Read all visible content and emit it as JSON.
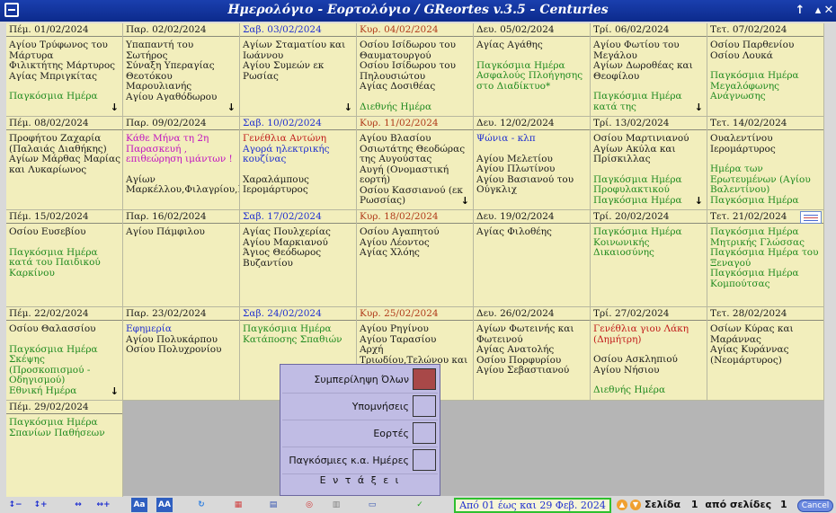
{
  "window": {
    "title": "Ημερολόγιο - Εορτολόγιο / GReortes v.3.5 - Centuries"
  },
  "colors": {
    "titlebar": "#0c2a8c",
    "cell_bg": "#f2eebc",
    "saturday": "#1f2fd0",
    "sunday": "#b03a1a",
    "world_day": "#1f8a1f",
    "popup_bg": "#c0bce4"
  },
  "weeks": [
    [
      {
        "header": "Πέμ. 01/02/2024",
        "hdr_color": "black",
        "lines": [
          {
            "t": "Αγίου Τρύφωνος του Μάρτυρα",
            "c": "black"
          },
          {
            "t": "Φιλικτήτης Μάρτυρος",
            "c": "black"
          },
          {
            "t": "Αγίας Μπριγκίτας",
            "c": "black"
          },
          {
            "gap": true
          },
          {
            "t": "Παγκόσμια Ημέρα",
            "c": "green"
          }
        ],
        "arrow": true
      },
      {
        "header": "Παρ. 02/02/2024",
        "hdr_color": "black",
        "lines": [
          {
            "t": "Υπαπαντή του Σωτήρος",
            "c": "black"
          },
          {
            "t": "Σύναξη Υπεραγίας Θεοτόκου Μαρουλιανής",
            "c": "black"
          },
          {
            "t": "Αγίου Αγαθόδωρου",
            "c": "black"
          }
        ],
        "arrow": true
      },
      {
        "header": "Σαβ. 03/02/2024",
        "hdr_color": "blue",
        "lines": [
          {
            "t": "Αγίων Σταματίου και Ιωάννου",
            "c": "black"
          },
          {
            "t": "Αγίου Συμεών εκ Ρωσίας",
            "c": "black"
          }
        ],
        "arrow": true
      },
      {
        "header": "Κυρ. 04/02/2024",
        "hdr_color": "red",
        "lines": [
          {
            "t": "Οσίου Ισίδωρου του Θαυματουργού",
            "c": "black"
          },
          {
            "t": "Οσίου Ισίδωρου του Πηλουσιώτου",
            "c": "black"
          },
          {
            "t": "Αγίας Δοσιθέας",
            "c": "black"
          },
          {
            "gap": true
          },
          {
            "t": "Διεθνής Ημέρα",
            "c": "green"
          }
        ],
        "arrow": false
      },
      {
        "header": "Δευ. 05/02/2024",
        "hdr_color": "black",
        "lines": [
          {
            "t": "Αγίας Αγάθης",
            "c": "black"
          },
          {
            "gap": true
          },
          {
            "t": "Παγκόσμια Ημέρα Ασφαλούς Πλοήγησης στο Διαδίκτυο*",
            "c": "green"
          }
        ],
        "arrow": false
      },
      {
        "header": "Τρί. 06/02/2024",
        "hdr_color": "black",
        "lines": [
          {
            "t": "Αγίου Φωτίου του Μεγάλου",
            "c": "black"
          },
          {
            "t": "Αγίων Δωροθέας και Θεοφίλου",
            "c": "black"
          },
          {
            "gap": true
          },
          {
            "t": "Παγκόσμια Ημέρα κατά της",
            "c": "green"
          }
        ],
        "arrow": true
      },
      {
        "header": "Τετ. 07/02/2024",
        "hdr_color": "black",
        "lines": [
          {
            "t": "Οσίου Παρθενίου",
            "c": "black"
          },
          {
            "t": "Οσίου Λουκά",
            "c": "black"
          },
          {
            "gap": true
          },
          {
            "t": "Παγκόσμια Ημέρα Μεγαλόφωνης Ανάγνωσης",
            "c": "green"
          }
        ],
        "arrow": false
      }
    ],
    [
      {
        "header": "Πέμ. 08/02/2024",
        "hdr_color": "black",
        "lines": [
          {
            "t": "Προφήτου Ζαχαρία (Παλαιάς Διαθήκης)",
            "c": "black"
          },
          {
            "t": "Αγίων Μάρθας Μαρίας και Λυκαρίωνος",
            "c": "black"
          }
        ],
        "arrow": false
      },
      {
        "header": "Παρ. 09/02/2024",
        "hdr_color": "black",
        "lines": [
          {
            "t": "Κάθε Μήνα τη 2η Παρασκευή , επιθεώρηση ιμάντων !",
            "c": "magenta"
          },
          {
            "gap": true
          },
          {
            "t": "Αγίων Μαρκέλλου,Φιλαγρίου,Παγκρατίου",
            "c": "black"
          }
        ],
        "arrow": false
      },
      {
        "header": "Σαβ. 10/02/2024",
        "hdr_color": "blue",
        "lines": [
          {
            "t": "Γενέθλια Αντώνη",
            "c": "crimson"
          },
          {
            "t": "Αγορά ηλεκτρικής κουζίνας",
            "c": "blue"
          },
          {
            "gap": true
          },
          {
            "t": "Χαραλάμπους Ιερομάρτυρος",
            "c": "black"
          }
        ],
        "arrow": false
      },
      {
        "header": "Κυρ. 11/02/2024",
        "hdr_color": "red",
        "lines": [
          {
            "t": "Αγίου Βλασίου",
            "c": "black"
          },
          {
            "t": "Οσιωτάτης Θεοδώρας της Αυγούστας",
            "c": "black"
          },
          {
            "t": "Αυγή (Ονομαστική εορτή)",
            "c": "black"
          },
          {
            "t": "Οσίου Κασσιανού (εκ Ρωσσίας)",
            "c": "black"
          }
        ],
        "arrow": true
      },
      {
        "header": "Δευ. 12/02/2024",
        "hdr_color": "black",
        "lines": [
          {
            "t": "Ψώνια - κλπ",
            "c": "blue"
          },
          {
            "gap": true
          },
          {
            "t": "Αγίου Μελετίου",
            "c": "black"
          },
          {
            "t": "Αγίου Πλωτίνου",
            "c": "black"
          },
          {
            "t": "Αγίου Βασιανού του Ούγκλιχ",
            "c": "black"
          }
        ],
        "arrow": false
      },
      {
        "header": "Τρί. 13/02/2024",
        "hdr_color": "black",
        "lines": [
          {
            "t": "Οσίου Μαρτινιανού",
            "c": "black"
          },
          {
            "t": "Αγίων Ακύλα και Πρίσκιλλας",
            "c": "black"
          },
          {
            "gap": true
          },
          {
            "t": "Παγκόσμια Ημέρα Προφυλακτικού",
            "c": "green"
          },
          {
            "t": "Παγκόσμια Ημέρα",
            "c": "green"
          }
        ],
        "arrow": true
      },
      {
        "header": "Τετ. 14/02/2024",
        "hdr_color": "black",
        "lines": [
          {
            "t": "Ουαλεντίνου Ιερομάρτυρος",
            "c": "black"
          },
          {
            "gap": true
          },
          {
            "t": "Ημέρα των Ερωτευμένων (Αγίου Βαλεντίνου)",
            "c": "green"
          },
          {
            "t": "Παγκόσμια Ημέρα",
            "c": "green"
          }
        ],
        "arrow": false
      }
    ],
    [
      {
        "header": "Πέμ. 15/02/2024",
        "hdr_color": "black",
        "lines": [
          {
            "t": "Οσίου Ευσεβίου",
            "c": "black"
          },
          {
            "gap": true
          },
          {
            "t": "Παγκόσμια Ημέρα κατά του Παιδικού Καρκίνου",
            "c": "green"
          }
        ],
        "arrow": false
      },
      {
        "header": "Παρ. 16/02/2024",
        "hdr_color": "black",
        "lines": [
          {
            "t": "Αγίου Πάμφιλου",
            "c": "black"
          }
        ],
        "arrow": false
      },
      {
        "header": "Σαβ. 17/02/2024",
        "hdr_color": "blue",
        "lines": [
          {
            "t": "Αγίας Πουλχερίας",
            "c": "black"
          },
          {
            "t": "Αγίου Μαρκιανού",
            "c": "black"
          },
          {
            "t": "Άγιος Θεόδωρος Βυζαντίου",
            "c": "black"
          }
        ],
        "arrow": false
      },
      {
        "header": "Κυρ. 18/02/2024",
        "hdr_color": "red",
        "lines": [
          {
            "t": "Οσίου Αγαπητού",
            "c": "black"
          },
          {
            "t": "Αγίου Λέοντος",
            "c": "black"
          },
          {
            "t": "Αγίας Χλόης",
            "c": "black"
          }
        ],
        "arrow": false
      },
      {
        "header": "Δευ. 19/02/2024",
        "hdr_color": "black",
        "lines": [
          {
            "t": "Αγίας Φιλοθέης",
            "c": "black"
          }
        ],
        "arrow": false
      },
      {
        "header": "Τρί. 20/02/2024",
        "hdr_color": "black",
        "lines": [
          {
            "t": "Παγκόσμια Ημέρα Κοινωνικής Δικαιοσύνης",
            "c": "green"
          }
        ],
        "arrow": false
      },
      {
        "header": "Τετ. 21/02/2024",
        "hdr_color": "black",
        "note": true,
        "lines": [
          {
            "t": "Παγκόσμια Ημέρα Μητρικής Γλώσσας",
            "c": "green"
          },
          {
            "t": "Παγκόσμια Ημέρα του Ξεναγού",
            "c": "green"
          },
          {
            "t": "Παγκόσμια Ημέρα Κομπούτσας",
            "c": "green"
          }
        ],
        "arrow": false
      }
    ],
    [
      {
        "header": "Πέμ. 22/02/2024",
        "hdr_color": "black",
        "lines": [
          {
            "t": "Οσίου Θαλασσίου",
            "c": "black"
          },
          {
            "gap": true
          },
          {
            "t": "Παγκόσμια Ημέρα Σκέψης (Προσκοπισμού - Οδηγισμού)",
            "c": "green"
          },
          {
            "t": "Εθνική Ημέρα",
            "c": "green"
          }
        ],
        "arrow": true
      },
      {
        "header": "Παρ. 23/02/2024",
        "hdr_color": "black",
        "lines": [
          {
            "t": "Εφημερία",
            "c": "blue"
          },
          {
            "t": "Αγίου Πολυκάρπου",
            "c": "black"
          },
          {
            "t": "Οσίου Πολυχρονίου",
            "c": "black"
          }
        ],
        "arrow": false
      },
      {
        "header": "Σαβ. 24/02/2024",
        "hdr_color": "blue",
        "lines": [
          {
            "t": "Παγκόσμια Ημέρα Κατάποσης Σπαθιών",
            "c": "green"
          }
        ],
        "arrow": false
      },
      {
        "header": "Κυρ. 25/02/2024",
        "hdr_color": "red",
        "lines": [
          {
            "t": "Αγίου Ρηγίνου",
            "c": "black"
          },
          {
            "t": "Αγίου Ταρασίου",
            "c": "black"
          },
          {
            "t": "Αρχή Τριωδίου,Τελώνου και",
            "c": "black"
          }
        ],
        "arrow": false
      },
      {
        "header": "Δευ. 26/02/2024",
        "hdr_color": "black",
        "lines": [
          {
            "t": "Αγίων Φωτεινής και Φωτεινού",
            "c": "black"
          },
          {
            "t": "Αγίας Ανατολής",
            "c": "black"
          },
          {
            "t": "Οσίου Πορφυρίου",
            "c": "black"
          },
          {
            "t": "Αγίου Σεβαστιανού",
            "c": "black"
          }
        ],
        "arrow": false
      },
      {
        "header": "Τρί. 27/02/2024",
        "hdr_color": "black",
        "lines": [
          {
            "t": "Γενέθλια γιου Λάκη (Δημήτρη)",
            "c": "crimson"
          },
          {
            "gap": true
          },
          {
            "t": "Οσίου Ασκληπιού",
            "c": "black"
          },
          {
            "t": "Αγίου Νήσιου",
            "c": "black"
          },
          {
            "gap": true
          },
          {
            "t": "Διεθνής Ημέρα",
            "c": "green"
          }
        ],
        "arrow": false
      },
      {
        "header": "Τετ. 28/02/2024",
        "hdr_color": "black",
        "lines": [
          {
            "t": "Οσίων Κύρας και Μαράννας",
            "c": "black"
          },
          {
            "t": "Αγίας Κυράννας (Νεομάρτυρος)",
            "c": "black"
          }
        ],
        "arrow": false
      }
    ],
    [
      {
        "header": "Πέμ. 29/02/2024",
        "hdr_color": "black",
        "lines": [
          {
            "t": "Παγκόσμια Ημέρα Σπανίων Παθήσεων",
            "c": "green"
          }
        ],
        "arrow": false
      }
    ]
  ],
  "popup": {
    "items": [
      {
        "label": "Συμπερίληψη Όλων",
        "checked": true
      },
      {
        "label": "Υπομνήσεις",
        "checked": false
      },
      {
        "label": "Εορτές",
        "checked": false
      },
      {
        "label": "Παγκόσμιες κ.α. Ημέρες",
        "checked": false
      }
    ],
    "ok_label": "Ε ν τ ά ξ ε ι"
  },
  "footer": {
    "range": "Από 01 έως και 29 Φεβ. 2024",
    "pager_label": "Σελίδα",
    "pager_current": "1",
    "pager_of": "από σελίδες",
    "pager_total": "1",
    "cancel_label": "Cancel",
    "tools": [
      "row-minus-icon",
      "row-plus-icon",
      "col-shrink-icon",
      "col-expand-icon",
      "font-smaller-icon",
      "font-larger-icon",
      "refresh-icon",
      "calendar-icon",
      "grid-icon",
      "search-icon",
      "table-icon",
      "notes-icon",
      "checklist-icon"
    ]
  }
}
